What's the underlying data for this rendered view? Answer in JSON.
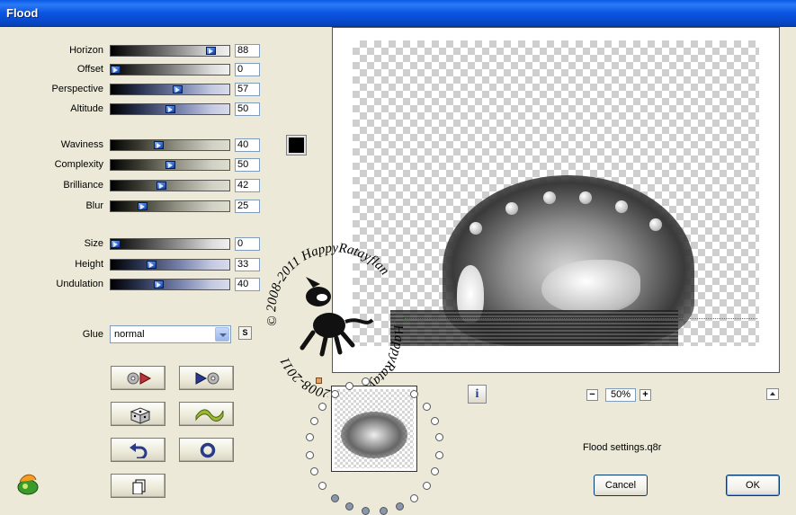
{
  "window": {
    "title": "Flood"
  },
  "sliders": [
    {
      "key": "horizon",
      "label": "Horizon",
      "value": "88",
      "fraction": 0.88,
      "style": "gray"
    },
    {
      "key": "offset",
      "label": "Offset",
      "value": "0",
      "fraction": 0.0,
      "style": "gray"
    },
    {
      "key": "perspective",
      "label": "Perspective",
      "value": "57",
      "fraction": 0.57,
      "style": "blue"
    },
    {
      "key": "altitude",
      "label": "Altitude",
      "value": "50",
      "fraction": 0.5,
      "style": "blue"
    },
    {
      "key": "waviness",
      "label": "Waviness",
      "value": "40",
      "fraction": 0.4,
      "style": "olive"
    },
    {
      "key": "complexity",
      "label": "Complexity",
      "value": "50",
      "fraction": 0.5,
      "style": "olive"
    },
    {
      "key": "brilliance",
      "label": "Brilliance",
      "value": "42",
      "fraction": 0.42,
      "style": "olive"
    },
    {
      "key": "blur",
      "label": "Blur",
      "value": "25",
      "fraction": 0.25,
      "style": "olive"
    },
    {
      "key": "size",
      "label": "Size",
      "value": "0",
      "fraction": 0.0,
      "style": "gray"
    },
    {
      "key": "height",
      "label": "Height",
      "value": "33",
      "fraction": 0.33,
      "style": "blue"
    },
    {
      "key": "undulation",
      "label": "Undulation",
      "value": "40",
      "fraction": 0.4,
      "style": "blue"
    }
  ],
  "glue": {
    "label": "Glue",
    "selected": "normal",
    "s_button": "S"
  },
  "color_swatch": "#000000",
  "preview": {
    "zoom": "50%",
    "zoom_minus": "−",
    "zoom_plus": "+",
    "info": "i",
    "settings_file": "Flood settings.q8r",
    "watermark_top": "© 2008-2011  HappyRatayflan",
    "watermark_bottom": "HappyRatayflan  © 2008-2011"
  },
  "action_buttons": [
    {
      "key": "play-start",
      "icon": "rewind-play-icon"
    },
    {
      "key": "play-end",
      "icon": "play-record-icon"
    },
    {
      "key": "random",
      "icon": "dice-icon"
    },
    {
      "key": "wave",
      "icon": "wave-icon"
    },
    {
      "key": "undo",
      "icon": "undo-icon"
    },
    {
      "key": "reset",
      "icon": "ring-icon"
    },
    {
      "key": "copy",
      "icon": "copy-icon"
    }
  ],
  "buttons": {
    "cancel": "Cancel",
    "ok": "OK"
  }
}
